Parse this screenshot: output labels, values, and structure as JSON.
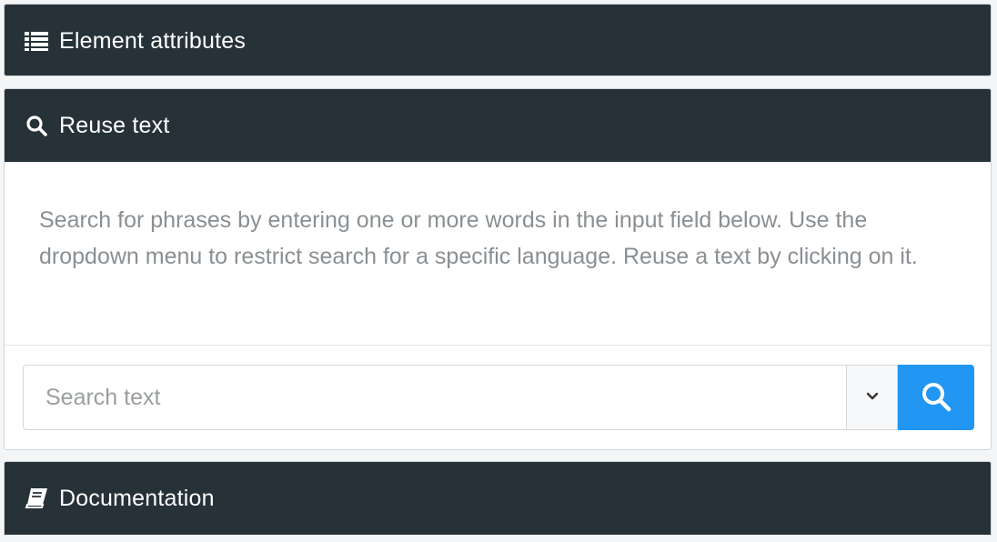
{
  "panels": {
    "attributes": {
      "title": "Element attributes",
      "icon": "list-icon"
    },
    "reuse": {
      "title": "Reuse text",
      "icon": "search-icon",
      "help": "Search for phrases by entering one or more words in the input field below. Use the dropdown menu to restrict search for a specific language. Reuse a text by clicking on it.",
      "search_placeholder": "Search text",
      "search_value": "",
      "language_icon": "chevron-down-icon",
      "search_button_icon": "search-icon"
    },
    "docs": {
      "title": "Documentation",
      "icon": "book-icon"
    }
  },
  "colors": {
    "header_bg": "#263238",
    "header_text": "#ffffff",
    "help_text": "#8a8f93",
    "search_button": "#2196f3"
  }
}
